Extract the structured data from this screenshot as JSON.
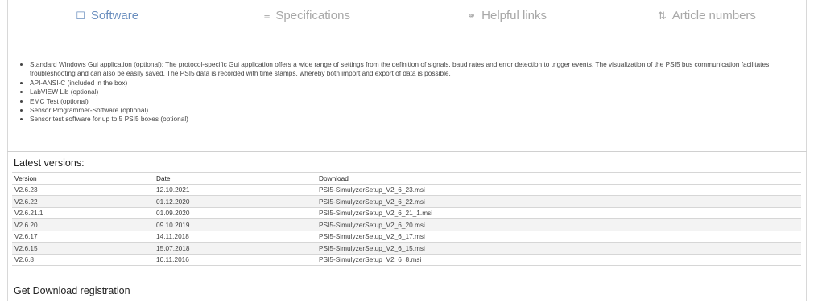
{
  "tabs": [
    {
      "icon": "comment-icon",
      "glyph": "☐",
      "label": "Software",
      "active": true
    },
    {
      "icon": "list-icon",
      "glyph": "≡",
      "label": "Specifications",
      "active": false
    },
    {
      "icon": "link-icon",
      "glyph": "⚭",
      "label": "Helpful links",
      "active": false
    },
    {
      "icon": "sort-icon",
      "glyph": "⇅",
      "label": "Article numbers",
      "active": false
    }
  ],
  "features": [
    "Standard Windows Gui application (optional): The protocol-specific Gui application offers a wide range of settings from the definition of signals, baud rates and error detection to trigger events. The visualization of the PSI5 bus communication facilitates troubleshooting and can also be easily saved. The PSI5 data is recorded with time stamps, whereby both import and export of data is possible.",
    "API-ANSI-C (included in the box)",
    "LabVIEW Lib (optional)",
    "EMC Test (optional)",
    "Sensor Programmer-Software (optional)",
    "Sensor test software for up to 5 PSI5 boxes (optional)"
  ],
  "latest_versions": {
    "heading": "Latest versions:",
    "columns": [
      "Version",
      "Date",
      "Download"
    ],
    "rows": [
      [
        "V2.6.23",
        "12.10.2021",
        "PSI5-SimulyzerSetup_V2_6_23.msi"
      ],
      [
        "V2.6.22",
        "01.12.2020",
        "PSI5-SimulyzerSetup_V2_6_22.msi"
      ],
      [
        "V2.6.21.1",
        "01.09.2020",
        "PSI5-SimulyzerSetup_V2_6_21_1.msi"
      ],
      [
        "V2.6.20",
        "09.10.2019",
        "PSI5-SimulyzerSetup_V2_6_20.msi"
      ],
      [
        "V2.6.17",
        "14.11.2018",
        "PSI5-SimulyzerSetup_V2_6_17.msi"
      ],
      [
        "V2.6.15",
        "15.07.2018",
        "PSI5-SimulyzerSetup_V2_6_15.msi"
      ],
      [
        "V2.6.8",
        "10.11.2016",
        "PSI5-SimulyzerSetup_V2_6_8.msi"
      ]
    ]
  },
  "footer": {
    "registration_label": "Get Download registration"
  },
  "colors": {
    "active_tab": "#6b8fbf",
    "inactive_tab": "#a8a8a8"
  }
}
